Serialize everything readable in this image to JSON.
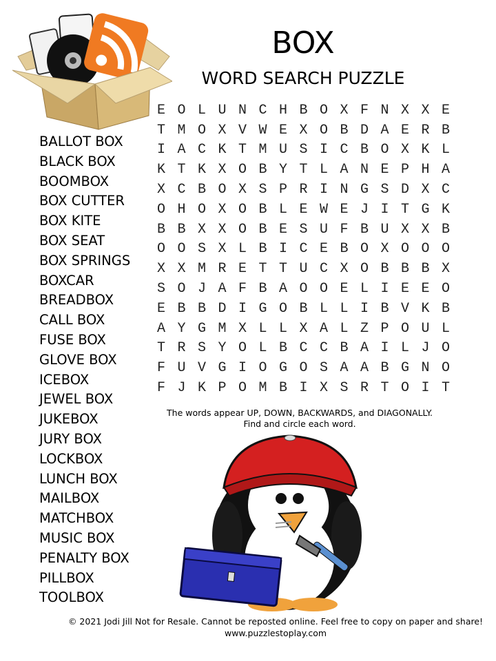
{
  "header": {
    "title": "BOX",
    "subtitle": "WORD SEARCH PUZZLE"
  },
  "images": {
    "header_icon": "open-cardboard-box-icon",
    "mascot": "penguin-with-toolbox-icon"
  },
  "grid": {
    "rows": [
      [
        "E",
        "O",
        "L",
        "U",
        "N",
        "C",
        "H",
        "B",
        "O",
        "X",
        "F",
        "N",
        "X",
        "X",
        "E"
      ],
      [
        "T",
        "M",
        "O",
        "X",
        "V",
        "W",
        "E",
        "X",
        "O",
        "B",
        "D",
        "A",
        "E",
        "R",
        "B"
      ],
      [
        "I",
        "A",
        "C",
        "K",
        "T",
        "M",
        "U",
        "S",
        "I",
        "C",
        "B",
        "O",
        "X",
        "K",
        "L"
      ],
      [
        "K",
        "T",
        "K",
        "X",
        "O",
        "B",
        "Y",
        "T",
        "L",
        "A",
        "N",
        "E",
        "P",
        "H",
        "A"
      ],
      [
        "X",
        "C",
        "B",
        "O",
        "X",
        "S",
        "P",
        "R",
        "I",
        "N",
        "G",
        "S",
        "D",
        "X",
        "C"
      ],
      [
        "O",
        "H",
        "O",
        "X",
        "O",
        "B",
        "L",
        "E",
        "W",
        "E",
        "J",
        "I",
        "T",
        "G",
        "K"
      ],
      [
        "B",
        "B",
        "X",
        "X",
        "O",
        "B",
        "E",
        "S",
        "U",
        "F",
        "B",
        "U",
        "X",
        "X",
        "B"
      ],
      [
        "O",
        "O",
        "S",
        "X",
        "L",
        "B",
        "I",
        "C",
        "E",
        "B",
        "O",
        "X",
        "O",
        "O",
        "O"
      ],
      [
        "X",
        "X",
        "M",
        "R",
        "E",
        "T",
        "T",
        "U",
        "C",
        "X",
        "O",
        "B",
        "B",
        "B",
        "X"
      ],
      [
        "S",
        "O",
        "J",
        "A",
        "F",
        "B",
        "A",
        "O",
        "O",
        "E",
        "L",
        "I",
        "E",
        "E",
        "O"
      ],
      [
        "E",
        "B",
        "B",
        "D",
        "I",
        "G",
        "O",
        "B",
        "L",
        "L",
        "I",
        "B",
        "V",
        "K",
        "B"
      ],
      [
        "A",
        "Y",
        "G",
        "M",
        "X",
        "L",
        "L",
        "X",
        "A",
        "L",
        "Z",
        "P",
        "O",
        "U",
        "L"
      ],
      [
        "T",
        "R",
        "S",
        "Y",
        "O",
        "L",
        "B",
        "C",
        "C",
        "B",
        "A",
        "I",
        "L",
        "J",
        "O"
      ],
      [
        "F",
        "U",
        "V",
        "G",
        "I",
        "O",
        "G",
        "O",
        "S",
        "A",
        "A",
        "B",
        "G",
        "N",
        "O"
      ],
      [
        "F",
        "J",
        "K",
        "P",
        "O",
        "M",
        "B",
        "I",
        "X",
        "S",
        "R",
        "T",
        "O",
        "I",
        "T"
      ]
    ]
  },
  "word_list": [
    "BALLOT BOX",
    "BLACK BOX",
    "BOOMBOX",
    "BOX CUTTER",
    "BOX KITE",
    "BOX SEAT",
    "BOX SPRINGS",
    "BOXCAR",
    "BREADBOX",
    "CALL BOX",
    "FUSE BOX",
    "GLOVE BOX",
    "ICEBOX",
    "JEWEL BOX",
    "JUKEBOX",
    "JURY BOX",
    "LOCKBOX",
    "LUNCH BOX",
    "MAILBOX",
    "MATCHBOX",
    "MUSIC BOX",
    "PENALTY BOX",
    "PILLBOX",
    "TOOLBOX"
  ],
  "instructions": {
    "line1": "The words appear UP, DOWN, BACKWARDS, and DIAGONALLY.",
    "line2": "Find and circle each word."
  },
  "footer": {
    "copyright": "© 2021  Jodi Jill Not for Resale. Cannot be reposted online. Feel free to copy on paper and share!",
    "website": "www.puzzlestoplay.com"
  }
}
